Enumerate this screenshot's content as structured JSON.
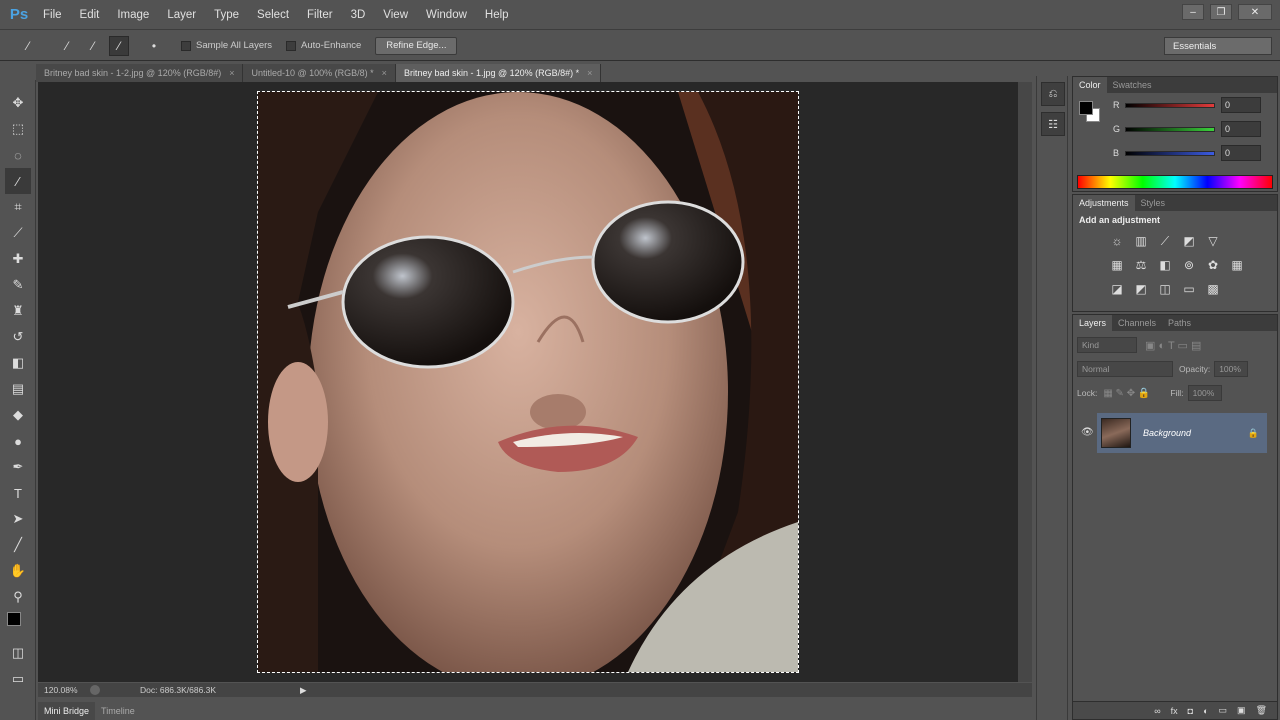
{
  "app": {
    "logo": "Ps"
  },
  "menu": [
    "File",
    "Edit",
    "Image",
    "Layer",
    "Type",
    "Select",
    "Filter",
    "3D",
    "View",
    "Window",
    "Help"
  ],
  "window_controls": [
    "‒",
    "❐",
    "✕"
  ],
  "options": {
    "sample_all_layers": "Sample All Layers",
    "auto_enhance": "Auto-Enhance",
    "refine_edge": "Refine Edge...",
    "workspace": "Essentials"
  },
  "tabs": [
    {
      "label": "Britney bad skin - 1-2.jpg @ 120% (RGB/8#)",
      "close": "×"
    },
    {
      "label": "Untitled-10 @ 100% (RGB/8) *",
      "close": "×"
    },
    {
      "label": "Britney bad skin - 1.jpg @ 120% (RGB/8#) *",
      "close": "×"
    }
  ],
  "status": {
    "zoom": "120.08%",
    "doc": "Doc: 686.3K/686.3K"
  },
  "bottom_tabs": [
    "Mini Bridge",
    "Timeline"
  ],
  "color_panel": {
    "tabs": [
      "Color",
      "Swatches"
    ],
    "channels": [
      {
        "label": "R",
        "value": "0",
        "color": "#e23b3b"
      },
      {
        "label": "G",
        "value": "0",
        "color": "#3bd23b"
      },
      {
        "label": "B",
        "value": "0",
        "color": "#3b5be2"
      }
    ]
  },
  "adjustments_panel": {
    "tabs": [
      "Adjustments",
      "Styles"
    ],
    "heading": "Add an adjustment"
  },
  "layers_panel": {
    "tabs": [
      "Layers",
      "Channels",
      "Paths"
    ],
    "kind": "Kind",
    "blend_mode": "Normal",
    "opacity_label": "Opacity:",
    "opacity_value": "100%",
    "lock_label": "Lock:",
    "fill_label": "Fill:",
    "fill_value": "100%",
    "layer_name": "Background",
    "footer_icons": [
      "∞",
      "fx",
      "◘",
      "◐",
      "▭",
      "▣",
      "🗑"
    ]
  }
}
